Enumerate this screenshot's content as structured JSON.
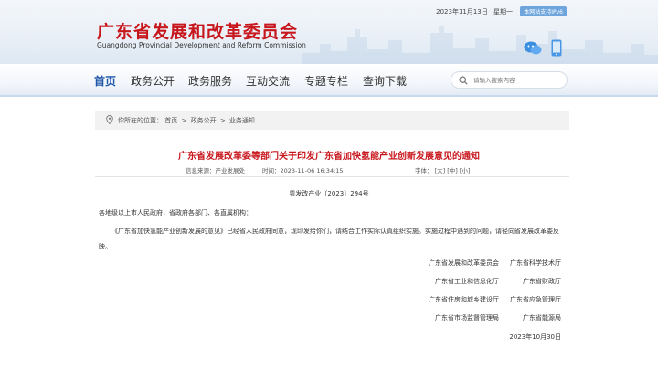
{
  "header": {
    "date": "2023年11月13日",
    "weekday": "星期一",
    "ipv6_badge": "本网站支持IPv6",
    "logo_cn": "广东省发展和改革委员会",
    "logo_en": "Guangdong Provincial Development and Reform Commission",
    "icons": [
      "wechat-icon",
      "mobile-icon"
    ]
  },
  "nav": {
    "items": [
      "首页",
      "政务公开",
      "政务服务",
      "互动交流",
      "专题专栏",
      "查询下载"
    ],
    "active_index": 0
  },
  "search": {
    "placeholder": "请输入搜索内容"
  },
  "breadcrumb": {
    "prefix": "你所在的位置：",
    "items": [
      "首页",
      "政务公开",
      "业务通知"
    ],
    "separator": ">"
  },
  "article": {
    "title": "广东省发展改革委等部门关于印发广东省加快氢能产业创新发展意见的通知",
    "source_label": "信息来源：产业发展处",
    "time_label": "时间：2023-11-06 16:34:15",
    "font_label": "字体：",
    "font_sizes": [
      "[大]",
      "[中]",
      "[小]"
    ],
    "doc_number": "粤发改产业〔2023〕294号",
    "salutation": "各地级以上市人民政府，省政府各部门、各直属机构：",
    "body": "《广东省加快氢能产业创新发展的意见》已经省人民政府同意，现印发给你们，请结合工作实际认真组织实施。实施过程中遇到的问题，请径向省发展改革委反映。",
    "signatories": [
      [
        "广东省发展和改革委员会",
        "广东省科学技术厅"
      ],
      [
        "广东省工业和信息化厅",
        "广东省财政厅"
      ],
      [
        "广东省住房和城乡建设厅",
        "广东省应急管理厅"
      ],
      [
        "广东省市场监督管理局",
        "广东省能源局"
      ]
    ],
    "date": "2023年10月30日"
  },
  "colors": {
    "brand_red": "#c8161d",
    "nav_active": "#1c54a8"
  }
}
